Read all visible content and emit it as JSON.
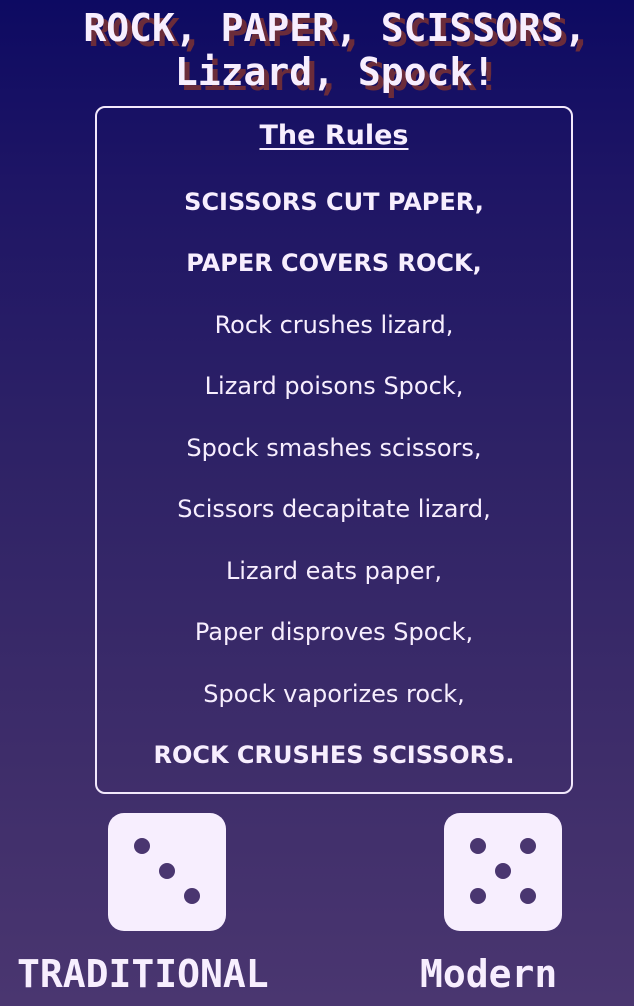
{
  "header": {
    "title_line1": "ROCK, PAPER, SCISSORS,",
    "title_line2": "Lizard, Spock!"
  },
  "rules": {
    "heading": "The Rules",
    "items": [
      "SCISSORS CUT PAPER,",
      "PAPER COVERS ROCK,",
      "Rock crushes lizard,",
      "Lizard poisons Spock,",
      "Spock smashes scissors,",
      "Scissors decapitate lizard,",
      "Lizard eats paper,",
      "Paper disproves Spock,",
      "Spock vaporizes rock,",
      "ROCK CRUSHES SCISSORS."
    ]
  },
  "modes": {
    "traditional": {
      "label": "TRADITIONAL",
      "icon": "dice-three-icon"
    },
    "modern": {
      "label": "Modern",
      "icon": "dice-five-icon"
    }
  },
  "colors": {
    "background_top": "#0d0a62",
    "background_bottom": "#4a3670",
    "text": "#f7eefe",
    "title_shadow": "#6b2c3a"
  }
}
